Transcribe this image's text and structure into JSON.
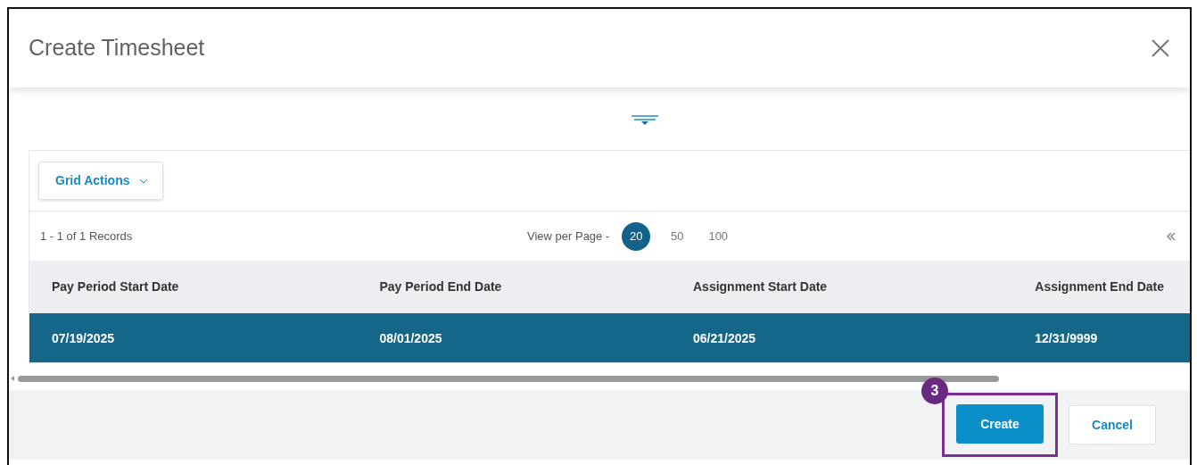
{
  "dialog": {
    "title": "Create Timesheet"
  },
  "grid": {
    "actions_label": "Grid Actions",
    "records": "1 - 1 of 1 Records",
    "view_per_page_label": "View per Page -",
    "page_sizes": [
      {
        "label": "20",
        "selected": true
      },
      {
        "label": "50",
        "selected": false
      },
      {
        "label": "100",
        "selected": false
      }
    ],
    "columns": [
      "Pay Period Start Date",
      "Pay Period End Date",
      "Assignment Start Date",
      "Assignment End Date"
    ],
    "rows": [
      {
        "selected": true,
        "cells": [
          "07/19/2025",
          "08/01/2025",
          "06/21/2025",
          "12/31/9999"
        ]
      }
    ]
  },
  "buttons": [
    {
      "label": "Create",
      "kind": "primary",
      "highlighted": true
    },
    {
      "label": "Cancel",
      "kind": "secondary",
      "highlighted": false
    }
  ],
  "callout": {
    "number": "3"
  }
}
